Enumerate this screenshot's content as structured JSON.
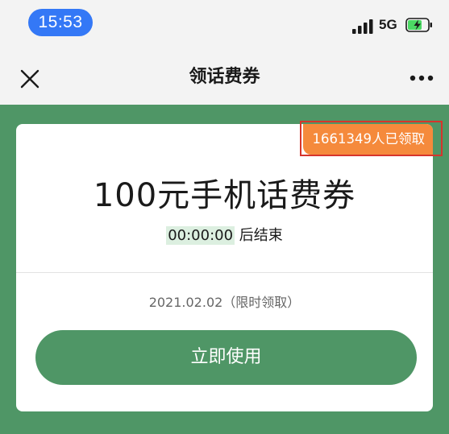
{
  "status_bar": {
    "time": "15:53",
    "network": "5G"
  },
  "nav": {
    "title": "领话费券"
  },
  "coupon": {
    "claimed_badge": "1661349人已领取",
    "title": "100元手机话费券",
    "countdown": "00:00:00",
    "countdown_suffix": " 后结束",
    "validity": "2021.02.02（限时领取）",
    "button_label": "立即使用"
  },
  "colors": {
    "accent_green": "#4f9666",
    "badge_orange": "#f58a3c",
    "time_pill_blue": "#3478f6",
    "highlight_red": "#d6352c"
  },
  "icons": [
    "signal-icon",
    "battery-charging-icon",
    "close-icon",
    "more-icon"
  ]
}
